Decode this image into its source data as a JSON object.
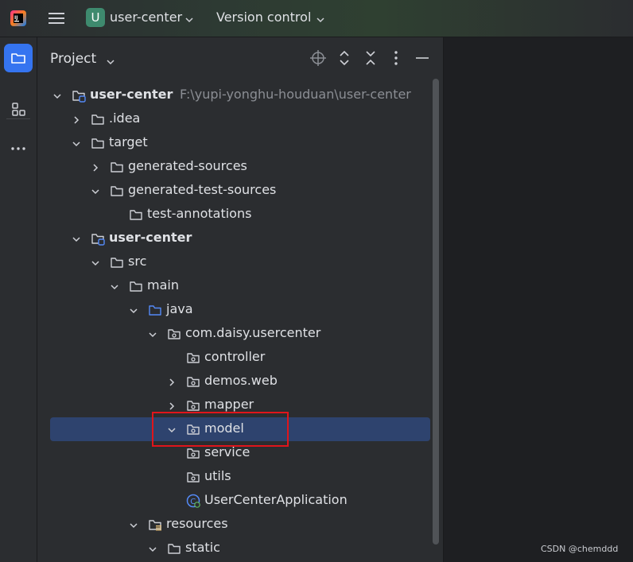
{
  "titlebar": {
    "project_badge": "U",
    "project_name": "user-center",
    "vcs_label": "Version control"
  },
  "panel": {
    "title": "Project",
    "header_icons": [
      "locate-icon",
      "expand-all-icon",
      "collapse-all-icon",
      "more-options-icon",
      "minimize-icon"
    ]
  },
  "tree": [
    {
      "label": "user-center",
      "path": "F:\\yupi-yonghu-houduan\\user-center",
      "bold": true,
      "arrow": "down",
      "icon": "module-folder-icon",
      "depth": 0
    },
    {
      "label": ".idea",
      "arrow": "right",
      "icon": "folder-icon",
      "depth": 1
    },
    {
      "label": "target",
      "arrow": "down",
      "icon": "folder-icon",
      "depth": 1
    },
    {
      "label": "generated-sources",
      "arrow": "right",
      "icon": "folder-icon",
      "depth": 2
    },
    {
      "label": "generated-test-sources",
      "arrow": "down",
      "icon": "folder-icon",
      "depth": 2
    },
    {
      "label": "test-annotations",
      "arrow": "none",
      "icon": "folder-icon",
      "depth": 3
    },
    {
      "label": "user-center",
      "bold": true,
      "arrow": "down",
      "icon": "module-folder-icon",
      "depth": 1
    },
    {
      "label": "src",
      "arrow": "down",
      "icon": "folder-icon",
      "depth": 2
    },
    {
      "label": "main",
      "arrow": "down",
      "icon": "folder-icon",
      "depth": 3
    },
    {
      "label": "java",
      "arrow": "down",
      "icon": "source-folder-icon",
      "depth": 4
    },
    {
      "label": "com.daisy.usercenter",
      "arrow": "down",
      "icon": "package-icon",
      "depth": 5
    },
    {
      "label": "controller",
      "arrow": "none",
      "icon": "package-icon",
      "depth": 6
    },
    {
      "label": "demos.web",
      "arrow": "right",
      "icon": "package-icon",
      "depth": 6
    },
    {
      "label": "mapper",
      "arrow": "right",
      "icon": "package-icon",
      "depth": 6
    },
    {
      "label": "model",
      "arrow": "down",
      "icon": "package-icon",
      "depth": 6,
      "selected": true
    },
    {
      "label": "service",
      "arrow": "none",
      "icon": "package-icon",
      "depth": 6
    },
    {
      "label": "utils",
      "arrow": "none",
      "icon": "package-icon",
      "depth": 6
    },
    {
      "label": "UserCenterApplication",
      "arrow": "none",
      "icon": "spring-boot-class-icon",
      "depth": 6
    },
    {
      "label": "resources",
      "arrow": "down",
      "icon": "resources-folder-icon",
      "depth": 4
    },
    {
      "label": "static",
      "arrow": "down",
      "icon": "folder-icon",
      "depth": 5
    }
  ],
  "watermark": "CSDN @chemddd",
  "colors": {
    "accent": "#3574f0",
    "selection": "#2e436e",
    "highlight_box": "#e0151b",
    "panel_bg": "#2b2d30",
    "badge": "#3e8a6e"
  }
}
